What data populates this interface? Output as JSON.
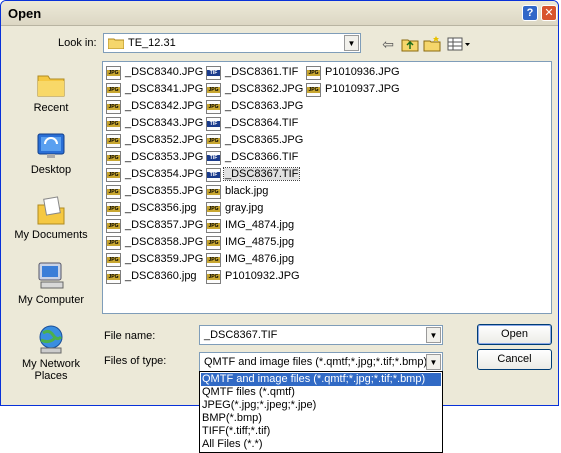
{
  "window": {
    "title": "Open"
  },
  "lookin": {
    "label": "Look in:",
    "value": "TE_12.31"
  },
  "places": [
    {
      "label": "Recent",
      "icon": "recent-folder-icon"
    },
    {
      "label": "Desktop",
      "icon": "desktop-icon"
    },
    {
      "label": "My Documents",
      "icon": "my-documents-icon"
    },
    {
      "label": "My Computer",
      "icon": "my-computer-icon"
    },
    {
      "label": "My Network Places",
      "icon": "network-places-icon"
    }
  ],
  "files": {
    "col1": [
      {
        "name": "_DSC8340.JPG",
        "type": "JPG"
      },
      {
        "name": "_DSC8341.JPG",
        "type": "JPG"
      },
      {
        "name": "_DSC8342.JPG",
        "type": "JPG"
      },
      {
        "name": "_DSC8343.JPG",
        "type": "JPG"
      },
      {
        "name": "_DSC8352.JPG",
        "type": "JPG"
      },
      {
        "name": "_DSC8353.JPG",
        "type": "JPG"
      },
      {
        "name": "_DSC8354.JPG",
        "type": "JPG"
      },
      {
        "name": "_DSC8355.JPG",
        "type": "JPG"
      },
      {
        "name": "_DSC8356.jpg",
        "type": "JPG"
      },
      {
        "name": "_DSC8357.JPG",
        "type": "JPG"
      },
      {
        "name": "_DSC8358.JPG",
        "type": "JPG"
      },
      {
        "name": "_DSC8359.JPG",
        "type": "JPG"
      },
      {
        "name": "_DSC8360.jpg",
        "type": "JPG"
      }
    ],
    "col2": [
      {
        "name": "_DSC8361.TIF",
        "type": "TIF"
      },
      {
        "name": "_DSC8362.JPG",
        "type": "JPG"
      },
      {
        "name": "_DSC8363.JPG",
        "type": "JPG"
      },
      {
        "name": "_DSC8364.TIF",
        "type": "TIF"
      },
      {
        "name": "_DSC8365.JPG",
        "type": "JPG"
      },
      {
        "name": "_DSC8366.TIF",
        "type": "TIF"
      },
      {
        "name": "_DSC8367.TIF",
        "type": "TIF"
      },
      {
        "name": "black.jpg",
        "type": "JPG"
      },
      {
        "name": "gray.jpg",
        "type": "JPG"
      },
      {
        "name": "IMG_4874.jpg",
        "type": "JPG"
      },
      {
        "name": "IMG_4875.jpg",
        "type": "JPG"
      },
      {
        "name": "IMG_4876.jpg",
        "type": "JPG"
      },
      {
        "name": "P1010932.JPG",
        "type": "JPG"
      }
    ],
    "col3": [
      {
        "name": "P1010936.JPG",
        "type": "JPG"
      },
      {
        "name": "P1010937.JPG",
        "type": "JPG"
      }
    ],
    "selected": "_DSC8367.TIF"
  },
  "filename": {
    "label": "File name:",
    "value": "_DSC8367.TIF"
  },
  "filetype": {
    "label": "Files of type:",
    "value": "QMTF and image files (*.qmtf;*.jpg;*.tif;*.bmp)",
    "options": [
      "QMTF and image files (*.qmtf;*.jpg;*.tif;*.bmp)",
      "QMTF files (*.qmtf)",
      "JPEG(*.jpg;*.jpeg;*.jpe)",
      "BMP(*.bmp)",
      "TIFF(*.tiff;*.tif)",
      "All Files (*.*)"
    ]
  },
  "buttons": {
    "open": "Open",
    "cancel": "Cancel",
    "help": "?",
    "close": "✕"
  },
  "colors": {
    "titlebar_border": "#0831d9",
    "selection": "#316ac5",
    "jpg_band": "#c8a630",
    "tif_band": "#1a3b8c"
  }
}
